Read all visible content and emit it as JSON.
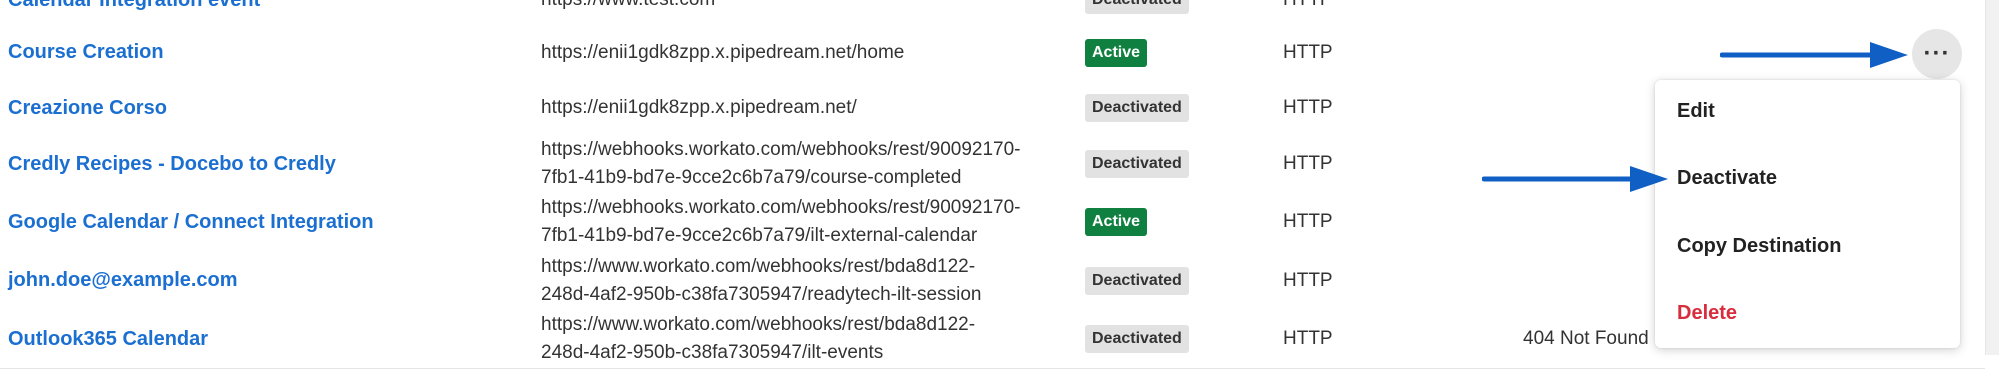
{
  "rows": [
    {
      "name": "Calendar Integration event",
      "url": "https://www.test.com",
      "status": "Deactivated",
      "type": "HTTP",
      "extra": ""
    },
    {
      "name": "Course Creation",
      "url": "https://enii1gdk8zpp.x.pipedream.net/home",
      "status": "Active",
      "type": "HTTP",
      "extra": ""
    },
    {
      "name": "Creazione Corso",
      "url": "https://enii1gdk8zpp.x.pipedream.net/",
      "status": "Deactivated",
      "type": "HTTP",
      "extra": ""
    },
    {
      "name": "Credly Recipes - Docebo to Credly",
      "url": "https://webhooks.workato.com/webhooks/rest/90092170-\n7fb1-41b9-bd7e-9cce2c6b7a79/course-completed",
      "status": "Deactivated",
      "type": "HTTP",
      "extra": ""
    },
    {
      "name": "Google Calendar / Connect Integration",
      "url": "https://webhooks.workato.com/webhooks/rest/90092170-\n7fb1-41b9-bd7e-9cce2c6b7a79/ilt-external-calendar",
      "status": "Active",
      "type": "HTTP",
      "extra": ""
    },
    {
      "name": "john.doe@example.com",
      "url": "https://www.workato.com/webhooks/rest/bda8d122-\n248d-4af2-950b-c38fa7305947/readytech-ilt-session",
      "status": "Deactivated",
      "type": "HTTP",
      "extra": ""
    },
    {
      "name": "Outlook365 Calendar",
      "url": "https://www.workato.com/webhooks/rest/bda8d122-\n248d-4af2-950b-c38fa7305947/ilt-events",
      "status": "Deactivated",
      "type": "HTTP",
      "extra": "404 Not Found"
    }
  ],
  "more_button": {
    "label": "···"
  },
  "menu": {
    "items": [
      {
        "label": "Edit"
      },
      {
        "label": "Deactivate"
      },
      {
        "label": "Copy Destination"
      },
      {
        "label": "Delete"
      }
    ]
  },
  "colors": {
    "link": "#1b6fd1",
    "active_badge": "#108040",
    "deactivated_badge": "#e2e2e2",
    "danger": "#d72d3c",
    "arrow": "#0f5fc4"
  }
}
